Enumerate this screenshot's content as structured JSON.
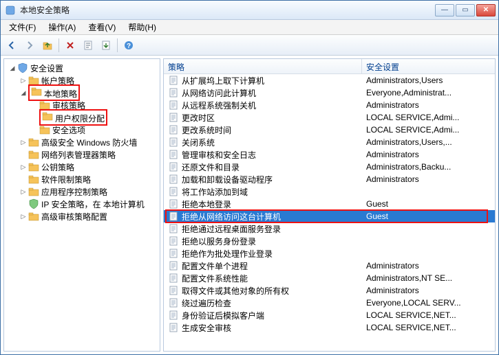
{
  "window": {
    "title": "本地安全策略"
  },
  "menu": {
    "file": "文件(F)",
    "action": "操作(A)",
    "view": "查看(V)",
    "help": "帮助(H)"
  },
  "toolbar": {
    "back": "后退",
    "forward": "前进",
    "up": "向上",
    "delete": "删除",
    "refresh": "刷新",
    "export": "导出列表",
    "help": "帮助"
  },
  "tree": {
    "root": "安全设置",
    "items": [
      {
        "label": "帐户策略",
        "expanded": false,
        "level": 2
      },
      {
        "label": "本地策略",
        "expanded": true,
        "level": 2,
        "highlight": true
      },
      {
        "label": "审核策略",
        "level": 3
      },
      {
        "label": "用户权限分配",
        "level": 3,
        "highlight": true
      },
      {
        "label": "安全选项",
        "level": 3
      },
      {
        "label": "高级安全 Windows 防火墙",
        "expanded": false,
        "level": 2
      },
      {
        "label": "网络列表管理器策略",
        "level": 2
      },
      {
        "label": "公钥策略",
        "expanded": false,
        "level": 2
      },
      {
        "label": "软件限制策略",
        "level": 2
      },
      {
        "label": "应用程序控制策略",
        "expanded": false,
        "level": 2
      },
      {
        "label": "IP 安全策略，在 本地计算机",
        "level": 2,
        "shield": true
      },
      {
        "label": "高级审核策略配置",
        "expanded": false,
        "level": 2
      }
    ]
  },
  "list": {
    "columns": {
      "policy": "策略",
      "setting": "安全设置"
    },
    "rows": [
      {
        "policy": "从扩展坞上取下计算机",
        "setting": "Administrators,Users"
      },
      {
        "policy": "从网络访问此计算机",
        "setting": "Everyone,Administrat..."
      },
      {
        "policy": "从远程系统强制关机",
        "setting": "Administrators"
      },
      {
        "policy": "更改时区",
        "setting": "LOCAL SERVICE,Admi..."
      },
      {
        "policy": "更改系统时间",
        "setting": "LOCAL SERVICE,Admi..."
      },
      {
        "policy": "关闭系统",
        "setting": "Administrators,Users,..."
      },
      {
        "policy": "管理审核和安全日志",
        "setting": "Administrators"
      },
      {
        "policy": "还原文件和目录",
        "setting": "Administrators,Backu..."
      },
      {
        "policy": "加载和卸载设备驱动程序",
        "setting": "Administrators"
      },
      {
        "policy": "将工作站添加到域",
        "setting": ""
      },
      {
        "policy": "拒绝本地登录",
        "setting": "Guest"
      },
      {
        "policy": "拒绝从网络访问这台计算机",
        "setting": "Guest",
        "selected": true,
        "highlight": true
      },
      {
        "policy": "拒绝通过远程桌面服务登录",
        "setting": ""
      },
      {
        "policy": "拒绝以服务身份登录",
        "setting": ""
      },
      {
        "policy": "拒绝作为批处理作业登录",
        "setting": ""
      },
      {
        "policy": "配置文件单个进程",
        "setting": "Administrators"
      },
      {
        "policy": "配置文件系统性能",
        "setting": "Administrators,NT SE..."
      },
      {
        "policy": "取得文件或其他对象的所有权",
        "setting": "Administrators"
      },
      {
        "policy": "绕过遍历检查",
        "setting": "Everyone,LOCAL SERV..."
      },
      {
        "policy": "身份验证后模拟客户端",
        "setting": "LOCAL SERVICE,NET..."
      },
      {
        "policy": "生成安全审核",
        "setting": "LOCAL SERVICE,NET..."
      }
    ]
  }
}
